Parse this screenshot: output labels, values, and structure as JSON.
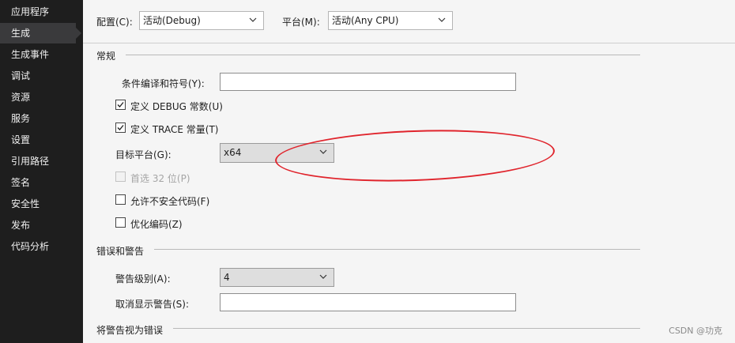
{
  "sidebar": {
    "items": [
      {
        "label": "应用程序"
      },
      {
        "label": "生成",
        "active": true
      },
      {
        "label": "生成事件"
      },
      {
        "label": "调试"
      },
      {
        "label": "资源"
      },
      {
        "label": "服务"
      },
      {
        "label": "设置"
      },
      {
        "label": "引用路径"
      },
      {
        "label": "签名"
      },
      {
        "label": "安全性"
      },
      {
        "label": "发布"
      },
      {
        "label": "代码分析"
      }
    ]
  },
  "topbar": {
    "config_label": "配置(C):",
    "config_value": "活动(Debug)",
    "platform_label": "平台(M):",
    "platform_value": "活动(Any CPU)"
  },
  "general": {
    "title": "常规",
    "conditional_symbols_label": "条件编译和符号(Y):",
    "conditional_symbols_value": "",
    "define_debug_label": "定义 DEBUG 常数(U)",
    "define_debug_checked": true,
    "define_trace_label": "定义 TRACE 常量(T)",
    "define_trace_checked": true,
    "target_platform_label": "目标平台(G):",
    "target_platform_value": "x64",
    "prefer32_label": "首选 32 位(P)",
    "prefer32_checked": false,
    "allow_unsafe_label": "允许不安全代码(F)",
    "allow_unsafe_checked": false,
    "optimize_label": "优化编码(Z)",
    "optimize_checked": false
  },
  "errors": {
    "title": "错误和警告",
    "warning_level_label": "警告级别(A):",
    "warning_level_value": "4",
    "suppress_label": "取消显示警告(S):",
    "suppress_value": ""
  },
  "treat_warnings": {
    "title": "将警告视为错误"
  },
  "watermark": "CSDN @功克",
  "colors": {
    "sidebar_bg": "#1e1e1e",
    "sidebar_active": "#3a3a3c",
    "annotation_circle": "#e0242c"
  }
}
